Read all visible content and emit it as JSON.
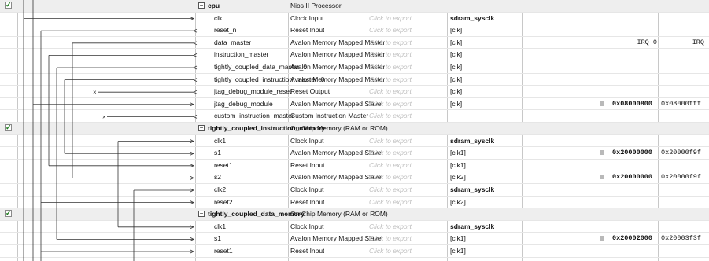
{
  "rows": [
    {
      "name": "cpu",
      "desc": "Nios II Processor",
      "export": "",
      "clock": "",
      "kind": "module",
      "checked": true
    },
    {
      "name": "clk",
      "desc": "Clock Input",
      "export": "Click to export",
      "clock": "sdram_sysclk",
      "clock_bold": true
    },
    {
      "name": "reset_n",
      "desc": "Reset Input",
      "export": "Click to export",
      "clock": "[clk]"
    },
    {
      "name": "data_master",
      "desc": "Avalon Memory Mapped Master",
      "export": "Click to export",
      "clock": "[clk]",
      "irq0": "IRQ 0",
      "irq": "IRQ"
    },
    {
      "name": "instruction_master",
      "desc": "Avalon Memory Mapped Master",
      "export": "Click to export",
      "clock": "[clk]"
    },
    {
      "name": "tightly_coupled_data_master_0",
      "desc": "Avalon Memory Mapped Master",
      "export": "Click to export",
      "clock": "[clk]"
    },
    {
      "name": "tightly_coupled_instruction_master_0",
      "desc": "Avalon Memory Mapped Master",
      "export": "Click to export",
      "clock": "[clk]"
    },
    {
      "name": "jtag_debug_module_reset",
      "desc": "Reset Output",
      "export": "Click to export",
      "clock": "[clk]"
    },
    {
      "name": "jtag_debug_module",
      "desc": "Avalon Memory Mapped Slave",
      "export": "Click to export",
      "clock": "[clk]",
      "base": "0x08000800",
      "end": "0x08000fff",
      "lock": true
    },
    {
      "name": "custom_instruction_master",
      "desc": "Custom Instruction Master",
      "export": "Click to export",
      "clock": ""
    },
    {
      "name": "tightly_coupled_instruction_memory",
      "desc": "On-Chip Memory (RAM or ROM)",
      "export": "",
      "clock": "",
      "kind": "module",
      "checked": true
    },
    {
      "name": "clk1",
      "desc": "Clock Input",
      "export": "Click to export",
      "clock": "sdram_sysclk",
      "clock_bold": true
    },
    {
      "name": "s1",
      "desc": "Avalon Memory Mapped Slave",
      "export": "Click to export",
      "clock": "[clk1]",
      "base": "0x20000000",
      "end": "0x20000f9f",
      "lock": true
    },
    {
      "name": "reset1",
      "desc": "Reset Input",
      "export": "Click to export",
      "clock": "[clk1]"
    },
    {
      "name": "s2",
      "desc": "Avalon Memory Mapped Slave",
      "export": "Click to export",
      "clock": "[clk2]",
      "base": "0x20000000",
      "end": "0x20000f9f",
      "lock": true
    },
    {
      "name": "clk2",
      "desc": "Clock Input",
      "export": "Click to export",
      "clock": "sdram_sysclk",
      "clock_bold": true
    },
    {
      "name": "reset2",
      "desc": "Reset Input",
      "export": "Click to export",
      "clock": "[clk2]"
    },
    {
      "name": "tightly_coupled_data_memory",
      "desc": "On-Chip Memory (RAM or ROM)",
      "export": "",
      "clock": "",
      "kind": "module",
      "checked": true
    },
    {
      "name": "clk1",
      "desc": "Clock Input",
      "export": "Click to export",
      "clock": "sdram_sysclk",
      "clock_bold": true
    },
    {
      "name": "s1",
      "desc": "Avalon Memory Mapped Slave",
      "export": "Click to export",
      "clock": "[clk1]",
      "base": "0x20002000",
      "end": "0x20003f3f",
      "lock": true
    },
    {
      "name": "reset1",
      "desc": "Reset Input",
      "export": "Click to export",
      "clock": "[clk1]"
    }
  ],
  "colors": {
    "export_text": "#bdbdbd",
    "highlight_row": "#eeeeee",
    "connection_line": "#333333"
  }
}
